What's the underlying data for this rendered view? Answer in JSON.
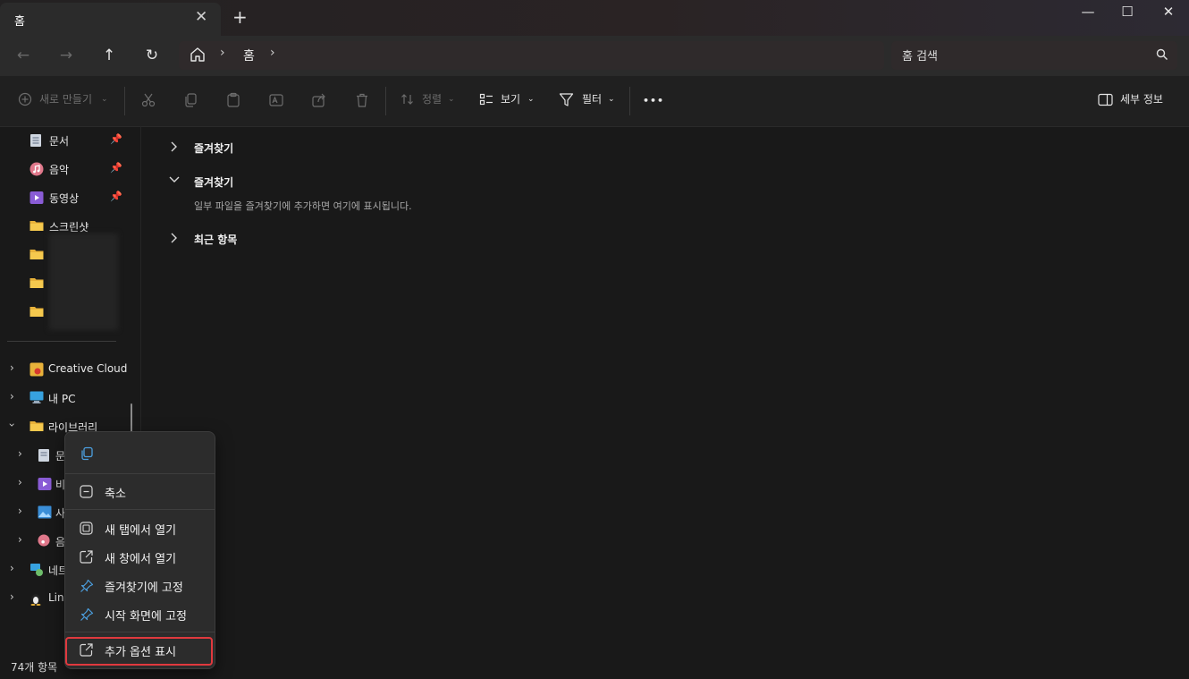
{
  "window": {
    "tab_title": "홈",
    "tab_close": "✕",
    "new_tab": "+",
    "minimize": "—",
    "maximize": "☐",
    "close": "✕"
  },
  "nav": {
    "back": "←",
    "forward": "→",
    "up": "↑",
    "refresh": "↻",
    "separator": "›",
    "breadcrumb": "홈",
    "search_placeholder": "홈 검색"
  },
  "toolbar": {
    "new_label": "새로 만들기",
    "sort_label": "정렬",
    "view_label": "보기",
    "filter_label": "필터",
    "more_label": "•••",
    "details_label": "세부 정보"
  },
  "sidebar": {
    "pinned": [
      {
        "label": "문서",
        "icon": "document-icon"
      },
      {
        "label": "음악",
        "icon": "music-icon"
      },
      {
        "label": "동영상",
        "icon": "video-icon"
      },
      {
        "label": "스크린샷",
        "icon": "folder-icon"
      }
    ],
    "tree": [
      {
        "label": "Creative Cloud",
        "icon": "creative-cloud-icon"
      },
      {
        "label": "내 PC",
        "icon": "pc-icon"
      },
      {
        "label": "라이브러리",
        "icon": "folder-icon"
      }
    ],
    "library_children": [
      {
        "label": "문",
        "icon": "document-icon"
      },
      {
        "label": "비",
        "icon": "video-icon"
      },
      {
        "label": "사",
        "icon": "picture-icon"
      },
      {
        "label": "음",
        "icon": "music-icon"
      }
    ],
    "network": {
      "label": "네트",
      "icon": "network-icon"
    },
    "linux": {
      "label": "Linu",
      "icon": "linux-icon"
    }
  },
  "content": {
    "section1": "즐겨찾기",
    "section2": "즐겨찾기",
    "empty_message": "일부 파일을 즐겨찾기에 추가하면 여기에 표시됩니다.",
    "section3": "최근 항목"
  },
  "status": {
    "item_count": "74개 항목"
  },
  "context_menu": {
    "collapse": "축소",
    "open_new_tab": "새 탭에서 열기",
    "open_new_window": "새 창에서 열기",
    "pin_favorites": "즐겨찾기에 고정",
    "pin_start": "시작 화면에 고정",
    "show_more": "추가 옵션 표시"
  },
  "colors": {
    "accent": "#4ca0e0",
    "highlight_border": "#e0393e",
    "folder": "#e8b23a"
  }
}
